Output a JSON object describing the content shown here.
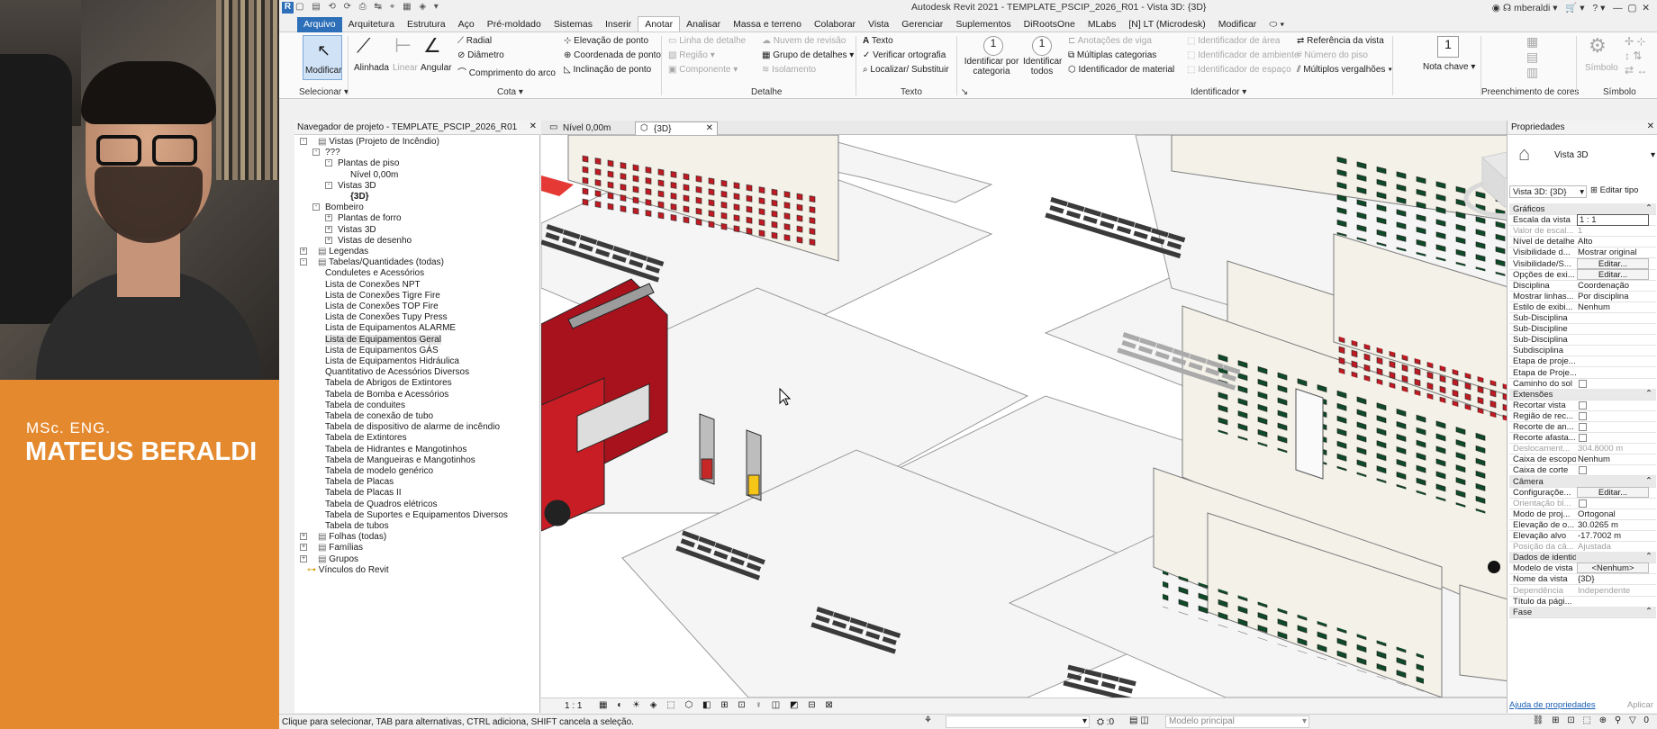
{
  "presenter": {
    "degree": "MSc. ENG.",
    "name": "MATEUS BERALDI"
  },
  "app": {
    "title": "Autodesk Revit 2021 - TEMPLATE_PSCIP_2026_R01 - Vista 3D: {3D}",
    "user": "mberaldi"
  },
  "tabs": [
    "Arquivo",
    "Arquitetura",
    "Estrutura",
    "Aço",
    "Pré-moldado",
    "Sistemas",
    "Inserir",
    "Anotar",
    "Analisar",
    "Massa e terreno",
    "Colaborar",
    "Vista",
    "Gerenciar",
    "Suplementos",
    "DiRootsOne",
    "MLabs",
    "[N] LT (Microdesk)",
    "Modificar"
  ],
  "ribbon": {
    "select": {
      "modify": "Modificar",
      "panel": "Selecionar"
    },
    "cota": {
      "aligned": "Alinhada",
      "linear": "Linear",
      "angular": "Angular",
      "radial": "Radial",
      "diameter": "Diâmetro",
      "arc": "Comprimento do arco",
      "elev": "Elevação de ponto",
      "coord": "Coordenada de ponto",
      "slope": "Inclinação de ponto",
      "panel": "Cota"
    },
    "detalhe": {
      "detail_line": "Linha de detalhe",
      "region": "Região",
      "component": "Componente",
      "cloud": "Nuvem de revisão",
      "group": "Grupo de detalhes",
      "insulation": "Isolamento",
      "panel": "Detalhe"
    },
    "texto": {
      "text": "Texto",
      "spell": "Verificar ortografia",
      "find": "Localizar/ Substituir",
      "panel": "Texto"
    },
    "identificador": {
      "by_cat": "Identificar por categoria",
      "all": "Identificar todos",
      "beam": "Anotações de viga",
      "multi": "Múltiplas categorias",
      "material": "Identificador de material",
      "area": "Identificador de área",
      "room": "Identificador de ambiente",
      "space": "Identificador de espaço",
      "step": "Número do piso",
      "ref": "Referência da vista",
      "multi_rebar": "Múltiplos vergalhões",
      "panel": "Identificador",
      "keynote": "Nota chave"
    },
    "cores": {
      "panel": "Preenchimento de cores"
    },
    "simbolo": {
      "symbol": "Símbolo",
      "panel": "Símbolo"
    }
  },
  "browser": {
    "title": "Navegador de projeto - TEMPLATE_PSCIP_2026_R01",
    "items": [
      {
        "t": "Vistas (Projeto de Incêndio)",
        "d": 0,
        "tog": "-"
      },
      {
        "t": "???",
        "d": 1,
        "tog": "-"
      },
      {
        "t": "Plantas de piso",
        "d": 2,
        "tog": "-"
      },
      {
        "t": "Nível 0,00m",
        "d": 3
      },
      {
        "t": "Vistas 3D",
        "d": 2,
        "tog": "-"
      },
      {
        "t": "{3D}",
        "d": 3,
        "bold": true
      },
      {
        "t": "Bombeiro",
        "d": 1,
        "tog": "-"
      },
      {
        "t": "Plantas de forro",
        "d": 2,
        "tog": "+"
      },
      {
        "t": "Vistas 3D",
        "d": 2,
        "tog": "+"
      },
      {
        "t": "Vistas de desenho",
        "d": 2,
        "tog": "+"
      },
      {
        "t": "Legendas",
        "d": 0,
        "tog": "+"
      },
      {
        "t": "Tabelas/Quantidades (todas)",
        "d": 0,
        "tog": "-"
      },
      {
        "t": "Conduletes e Acessórios",
        "d": 1
      },
      {
        "t": "Lista de Conexões NPT",
        "d": 1
      },
      {
        "t": "Lista de Conexões Tigre Fire",
        "d": 1
      },
      {
        "t": "Lista de Conexões TOP Fire",
        "d": 1
      },
      {
        "t": "Lista de Conexões Tupy Press",
        "d": 1
      },
      {
        "t": "Lista de Equipamentos ALARME",
        "d": 1
      },
      {
        "t": "Lista de Equipamentos Geral",
        "d": 1,
        "sel": true
      },
      {
        "t": "Lista de Equipamentos GÁS",
        "d": 1
      },
      {
        "t": "Lista de Equipamentos Hidráulica",
        "d": 1
      },
      {
        "t": "Quantitativo de Acessórios Diversos",
        "d": 1
      },
      {
        "t": "Tabela de Abrigos de Extintores",
        "d": 1
      },
      {
        "t": "Tabela de Bomba e Acessórios",
        "d": 1
      },
      {
        "t": "Tabela de conduites",
        "d": 1
      },
      {
        "t": "Tabela de conexão de tubo",
        "d": 1
      },
      {
        "t": "Tabela de dispositivo de alarme de incêndio",
        "d": 1
      },
      {
        "t": "Tabela de Extintores",
        "d": 1
      },
      {
        "t": "Tabela de Hidrantes e Mangotinhos",
        "d": 1
      },
      {
        "t": "Tabela de Mangueiras e Mangotinhos",
        "d": 1
      },
      {
        "t": "Tabela de modelo genérico",
        "d": 1
      },
      {
        "t": "Tabela de Placas",
        "d": 1
      },
      {
        "t": "Tabela de Placas II",
        "d": 1
      },
      {
        "t": "Tabela de Quadros elétricos",
        "d": 1
      },
      {
        "t": "Tabela de Suportes e Equipamentos Diversos",
        "d": 1
      },
      {
        "t": "Tabela de tubos",
        "d": 1
      },
      {
        "t": "Folhas (todas)",
        "d": 0,
        "tog": "+"
      },
      {
        "t": "Famílias",
        "d": 0,
        "tog": "+"
      },
      {
        "t": "Grupos",
        "d": 0,
        "tog": "+"
      },
      {
        "t": "Vínculos do Revit",
        "d": 0,
        "link": true
      }
    ]
  },
  "viewtabs": [
    "Nível 0,00m",
    "{3D}"
  ],
  "viewcontrol": {
    "scale": "1 : 1"
  },
  "props": {
    "title": "Propriedades",
    "family": "Vista 3D",
    "selector": "Vista 3D: {3D}",
    "edit_type": "Editar tipo",
    "rows": [
      {
        "g": "Gráficos"
      },
      {
        "k": "Escala da vista",
        "v": "1 : 1",
        "box": true
      },
      {
        "k": "Valor de escal...",
        "v": "1",
        "dis": true
      },
      {
        "k": "Nível de detalhe",
        "v": "Alto"
      },
      {
        "k": "Visibilidade d...",
        "v": "Mostrar original"
      },
      {
        "k": "Visibilidade/S...",
        "btn": "Editar..."
      },
      {
        "k": "Opções de exi...",
        "btn": "Editar..."
      },
      {
        "k": "Disciplina",
        "v": "Coordenação"
      },
      {
        "k": "Mostrar linhas...",
        "v": "Por disciplina"
      },
      {
        "k": "Estilo de exibi...",
        "v": "Nenhum"
      },
      {
        "k": "Sub-Disciplina"
      },
      {
        "k": "Sub-Discipline"
      },
      {
        "k": "Sub-Disciplina"
      },
      {
        "k": "Subdisciplina"
      },
      {
        "k": "Etapa de proje..."
      },
      {
        "k": "Etapa de Proje..."
      },
      {
        "k": "Caminho do sol",
        "cb": true
      },
      {
        "g": "Extensões"
      },
      {
        "k": "Recortar vista",
        "cb": true
      },
      {
        "k": "Região de rec...",
        "cb": true
      },
      {
        "k": "Recorte de an...",
        "cb": true
      },
      {
        "k": "Recorte afasta...",
        "cb": true
      },
      {
        "k": "Deslocament...",
        "v": "304.8000 m",
        "dis": true
      },
      {
        "k": "Caixa de escopo",
        "v": "Nenhum"
      },
      {
        "k": "Caixa de corte",
        "cb": true
      },
      {
        "g": "Câmera"
      },
      {
        "k": "Configuraçõe...",
        "btn": "Editar..."
      },
      {
        "k": "Orientação bl...",
        "cb": true,
        "dis": true
      },
      {
        "k": "Modo de proj...",
        "v": "Ortogonal"
      },
      {
        "k": "Elevação de o...",
        "v": "30.0265 m"
      },
      {
        "k": "Elevação alvo",
        "v": "-17.7002 m"
      },
      {
        "k": "Posição da câ...",
        "v": "Ajustada",
        "dis": true
      },
      {
        "g": "Dados de identidade"
      },
      {
        "k": "Modelo de vista",
        "btn": "<Nenhum>"
      },
      {
        "k": "Nome da vista",
        "v": "{3D}"
      },
      {
        "k": "Dependência",
        "v": "Independente",
        "dis": true
      },
      {
        "k": "Título da pági..."
      },
      {
        "g": "Fase"
      }
    ],
    "help": "Ajuda de propriedades",
    "apply": "Aplicar"
  },
  "status": {
    "text": "Clique para selecionar, TAB para alternativas, CTRL adiciona, SHIFT cancela a seleção.",
    "zero": ":0",
    "model": "Modelo principal"
  }
}
